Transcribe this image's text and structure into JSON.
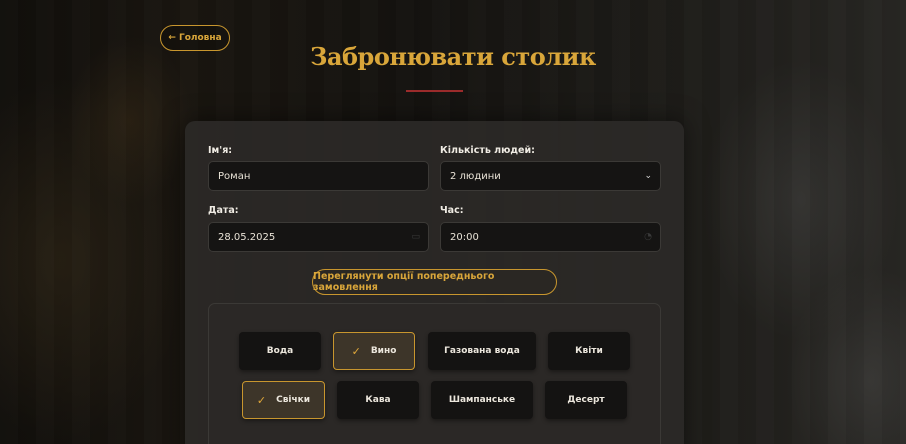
{
  "nav": {
    "back_label": "← Головна"
  },
  "page": {
    "title": "Забронювати столик"
  },
  "form": {
    "name": {
      "label": "Ім'я:",
      "value": "Роман"
    },
    "people": {
      "label": "Кількість людей:",
      "value": "2 людини"
    },
    "date": {
      "label": "Дата:",
      "value": "28.05.2025"
    },
    "time": {
      "label": "Час:",
      "value": "20:00"
    },
    "preorder_button": "Переглянути опції попереднього замовлення"
  },
  "options": [
    {
      "label": "Вода",
      "selected": false
    },
    {
      "label": "Вино",
      "selected": true
    },
    {
      "label": "Газована вода",
      "selected": false
    },
    {
      "label": "Квіти",
      "selected": false
    },
    {
      "label": "Свічки",
      "selected": true
    },
    {
      "label": "Кава",
      "selected": false
    },
    {
      "label": "Шампанське",
      "selected": false
    },
    {
      "label": "Десерт",
      "selected": false
    }
  ],
  "icons": {
    "check": "check-icon",
    "calendar": "calendar-icon",
    "clock": "clock-icon",
    "chevron": "chevron-down-icon"
  },
  "colors": {
    "accent": "#d9a63a",
    "divider": "#9b2b2b",
    "card": "#2b2927"
  }
}
